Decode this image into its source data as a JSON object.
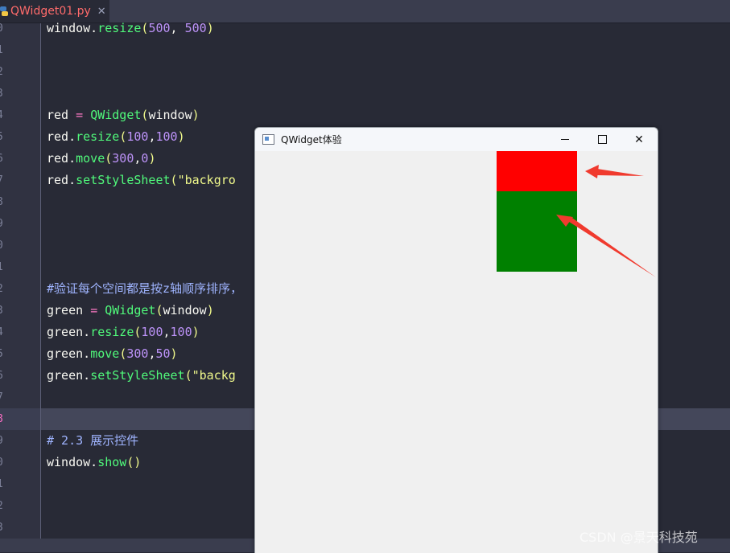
{
  "tab": {
    "filename": "QWidget01.py",
    "close": "✕"
  },
  "gutter_lines": [
    "0",
    "1",
    "2",
    "3",
    "4",
    "5",
    "6",
    "7",
    "8",
    "9",
    "0",
    "1",
    "2",
    "3",
    "4",
    "5",
    "6",
    "7",
    "8",
    "9",
    "0",
    "1",
    "2",
    "3"
  ],
  "code": {
    "l0": {
      "a": "window.",
      "b": "resize",
      "c": "(",
      "d": "500",
      "e": ", ",
      "f": "500",
      "g": ")"
    },
    "l4": {
      "a": "red ",
      "b": "=",
      "c": " ",
      "d": "QWidget",
      "e": "(",
      "f": "window",
      "g": ")"
    },
    "l5": {
      "a": "red.",
      "b": "resize",
      "c": "(",
      "d": "100",
      "e": ",",
      "f": "100",
      "g": ")"
    },
    "l6": {
      "a": "red.",
      "b": "move",
      "c": "(",
      "d": "300",
      "e": ",",
      "f": "0",
      "g": ")"
    },
    "l7": {
      "a": "red.",
      "b": "setStyleSheet",
      "c": "(",
      "d": "\"backgro"
    },
    "l12": {
      "text": "#验证每个空间都是按z轴顺序排序，"
    },
    "l13": {
      "a": "green ",
      "b": "=",
      "c": " ",
      "d": "QWidget",
      "e": "(",
      "f": "window",
      "g": ")"
    },
    "l14": {
      "a": "green.",
      "b": "resize",
      "c": "(",
      "d": "100",
      "e": ",",
      "f": "100",
      "g": ")"
    },
    "l15": {
      "a": "green.",
      "b": "move",
      "c": "(",
      "d": "300",
      "e": ",",
      "f": "50",
      "g": ")"
    },
    "l16": {
      "a": "green.",
      "b": "setStyleSheet",
      "c": "(",
      "d": "\"backg"
    },
    "l19": {
      "text": "# 2.3 展示控件"
    },
    "l20": {
      "a": "window.",
      "b": "show",
      "c": "()"
    }
  },
  "qt_window": {
    "title": "QWidget体验",
    "min_icon": "minimize-icon",
    "max_icon": "maximize-icon",
    "close_glyph": "✕"
  },
  "colors": {
    "red": "#ff0000",
    "green": "#008000",
    "arrow": "#f03a2e"
  },
  "watermark": "CSDN @景天科技苑"
}
